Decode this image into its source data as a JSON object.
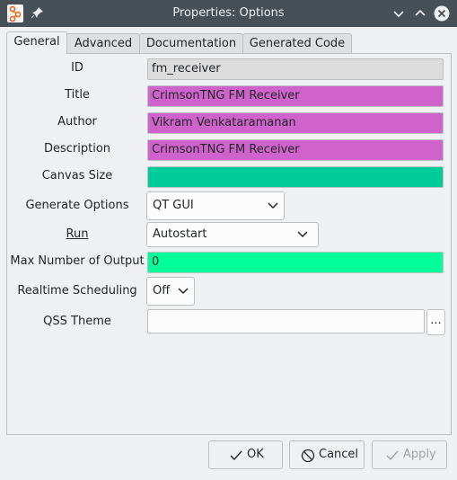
{
  "window": {
    "title": "Properties: Options"
  },
  "tabs": [
    {
      "label": "General"
    },
    {
      "label": "Advanced"
    },
    {
      "label": "Documentation"
    },
    {
      "label": "Generated Code"
    }
  ],
  "fields": {
    "id": {
      "label": "ID",
      "value": "fm_receiver"
    },
    "title": {
      "label": "Title",
      "value": "CrimsonTNG FM Receiver"
    },
    "author": {
      "label": "Author",
      "value": "Vikram Venkataramanan"
    },
    "description": {
      "label": "Description",
      "value": "CrimsonTNG FM Receiver"
    },
    "canvas_size": {
      "label": "Canvas Size",
      "value": ""
    },
    "generate_options": {
      "label": "Generate Options",
      "value": "QT GUI"
    },
    "run": {
      "label": "Run",
      "value": "Autostart"
    },
    "max_outputs": {
      "label": "Max Number of Output",
      "value": "0"
    },
    "realtime": {
      "label": "Realtime Scheduling",
      "value": "Off"
    },
    "qss_theme": {
      "label": "QSS Theme",
      "value": "",
      "browse_label": "..."
    }
  },
  "buttons": {
    "ok": "OK",
    "cancel": "Cancel",
    "apply": "Apply"
  },
  "colors": {
    "string_field": "#d062cc",
    "readonly_field": "#dcdcdc",
    "canvas_field": "#00cc99",
    "int_field": "#00ff99",
    "titlebar": "#475057",
    "accent": "#3daee9"
  },
  "icons": {
    "app": "gnuradio-app-icon",
    "pin": "pin-icon",
    "minimize": "minimize-icon",
    "maximize": "maximize-icon",
    "close": "close-icon",
    "ok": "check-icon",
    "cancel": "cancel-icon",
    "apply": "check-icon"
  }
}
